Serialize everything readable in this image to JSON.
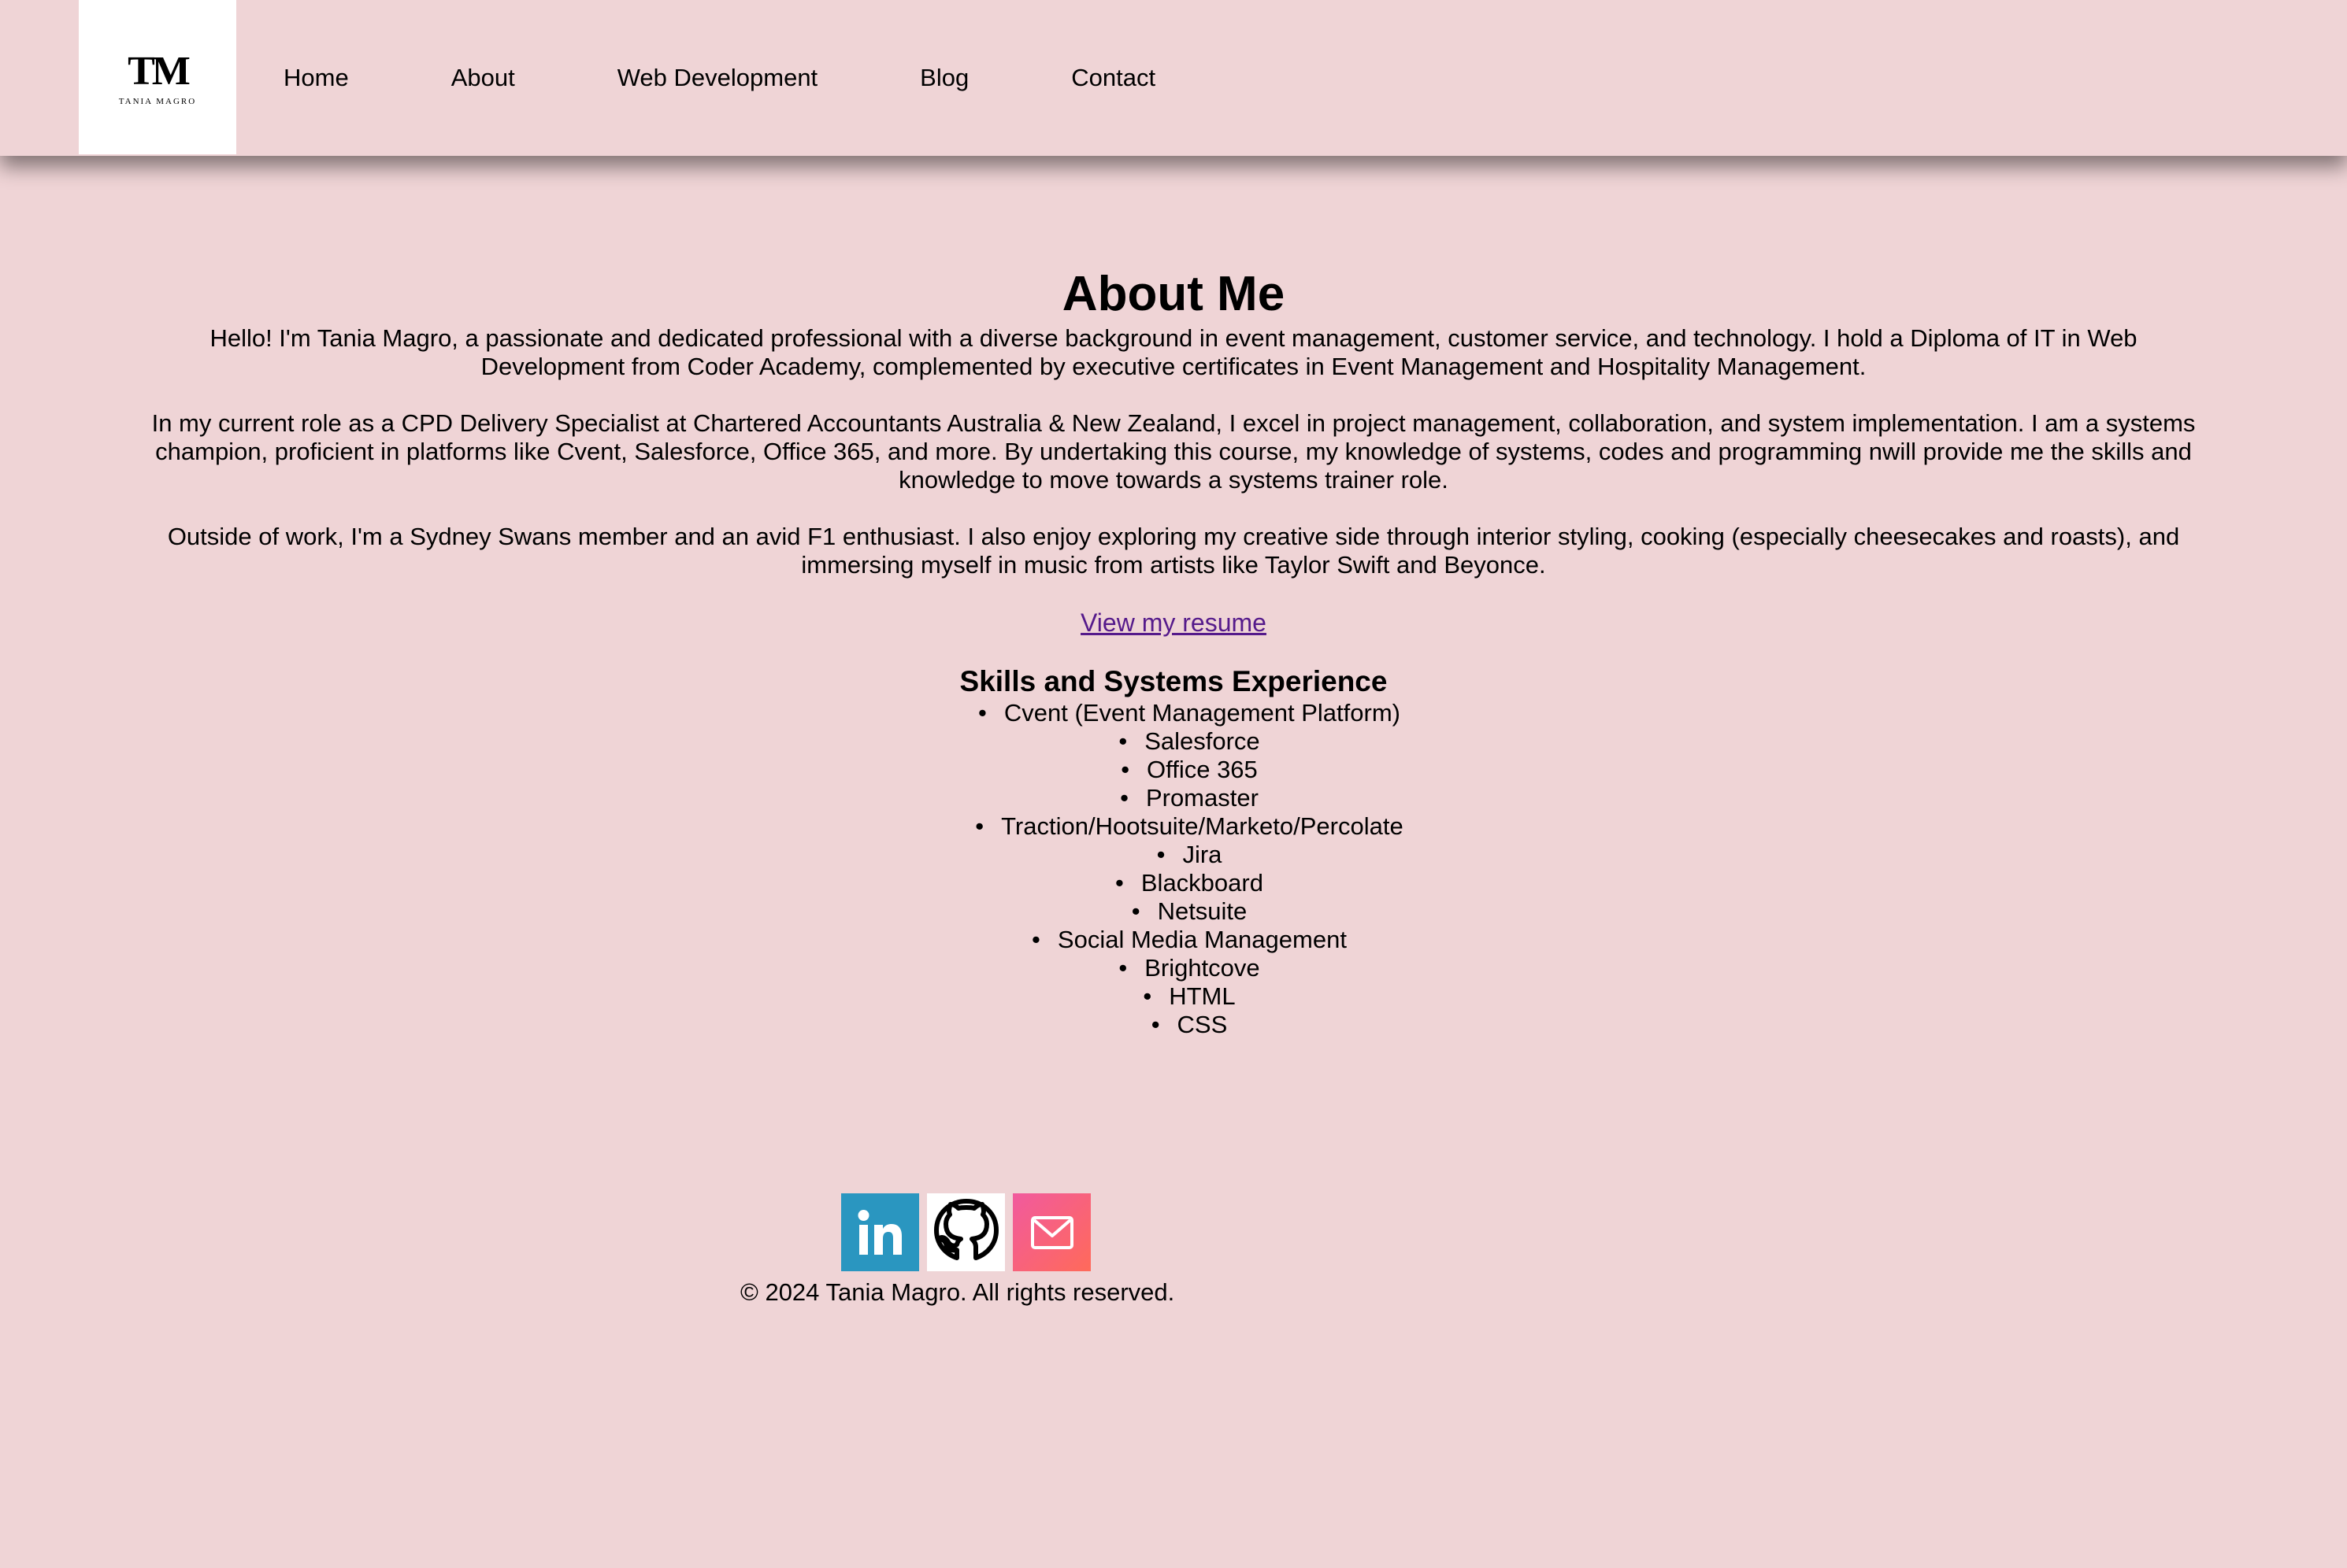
{
  "header": {
    "logo_mark": "TM",
    "logo_name": "TANIA MAGRO",
    "nav": [
      "Home",
      "About",
      "Web Development",
      "Blog",
      "Contact"
    ]
  },
  "about": {
    "title": "About Me",
    "paragraphs": [
      "Hello! I'm Tania Magro, a passionate and dedicated professional with a diverse background in event management, customer service, and technology. I hold a Diploma of IT in Web Development from Coder Academy, complemented by executive certificates in Event Management and Hospitality Management.",
      "In my current role as a CPD Delivery Specialist at Chartered Accountants Australia & New Zealand, I excel in project management, collaboration, and system implementation. I am a systems champion, proficient in platforms like Cvent, Salesforce, Office 365, and more. By undertaking this course, my knowledge of systems, codes and programming nwill provide me the skills and knowledge to move towards a systems trainer role.",
      "Outside of work, I'm a Sydney Swans member and an avid F1 enthusiast. I also enjoy exploring my creative side through interior styling, cooking (especially cheesecakes and roasts), and immersing myself in music from artists like Taylor Swift and Beyonce."
    ],
    "resume_link": "View my resume"
  },
  "skills": {
    "title": "Skills and Systems Experience",
    "items": [
      "Cvent (Event Management Platform)",
      "Salesforce",
      "Office 365",
      "Promaster",
      "Traction/Hootsuite/Marketo/Percolate",
      "Jira",
      "Blackboard",
      "Netsuite",
      "Social Media Management",
      "Brightcove",
      "HTML",
      "CSS"
    ]
  },
  "footer": {
    "social_icons": [
      "linkedin-icon",
      "github-icon",
      "mail-icon"
    ],
    "copyright": "© 2024 Tania Magro. All rights reserved."
  },
  "colors": {
    "background": "#efd4d6",
    "link_visited": "#551a8b",
    "linkedin": "#2a96c0",
    "mail_gradient_start": "#f15a9e",
    "mail_gradient_end": "#ff6a5a"
  }
}
